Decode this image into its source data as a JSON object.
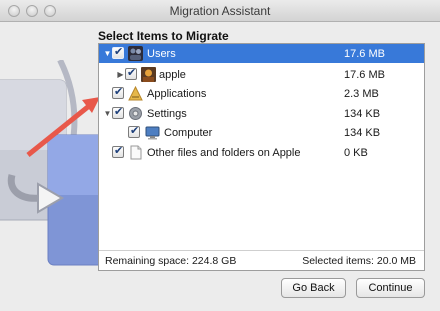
{
  "window": {
    "title": "Migration Assistant"
  },
  "heading": "Select Items to Migrate",
  "items": [
    {
      "label": "Users",
      "size": "17.6 MB",
      "selected": true,
      "icon": "users-icon"
    },
    {
      "label": "apple",
      "size": "17.6 MB",
      "selected": false,
      "icon": "user-avatar-icon"
    },
    {
      "label": "Applications",
      "size": "2.3 MB",
      "selected": false,
      "icon": "applications-icon"
    },
    {
      "label": "Settings",
      "size": "134 KB",
      "selected": false,
      "icon": "gear-icon"
    },
    {
      "label": "Computer",
      "size": "134 KB",
      "selected": false,
      "icon": "computer-icon"
    },
    {
      "label": "Other files and folders on Apple",
      "size": "0 KB",
      "selected": false,
      "icon": "document-icon"
    }
  ],
  "status": {
    "remaining": "Remaining space: 224.8 GB",
    "selected": "Selected items: 20.0 MB"
  },
  "buttons": {
    "back": "Go Back",
    "continue": "Continue"
  },
  "colors": {
    "selection": "#3879d9",
    "arrow": "#e8584a"
  }
}
